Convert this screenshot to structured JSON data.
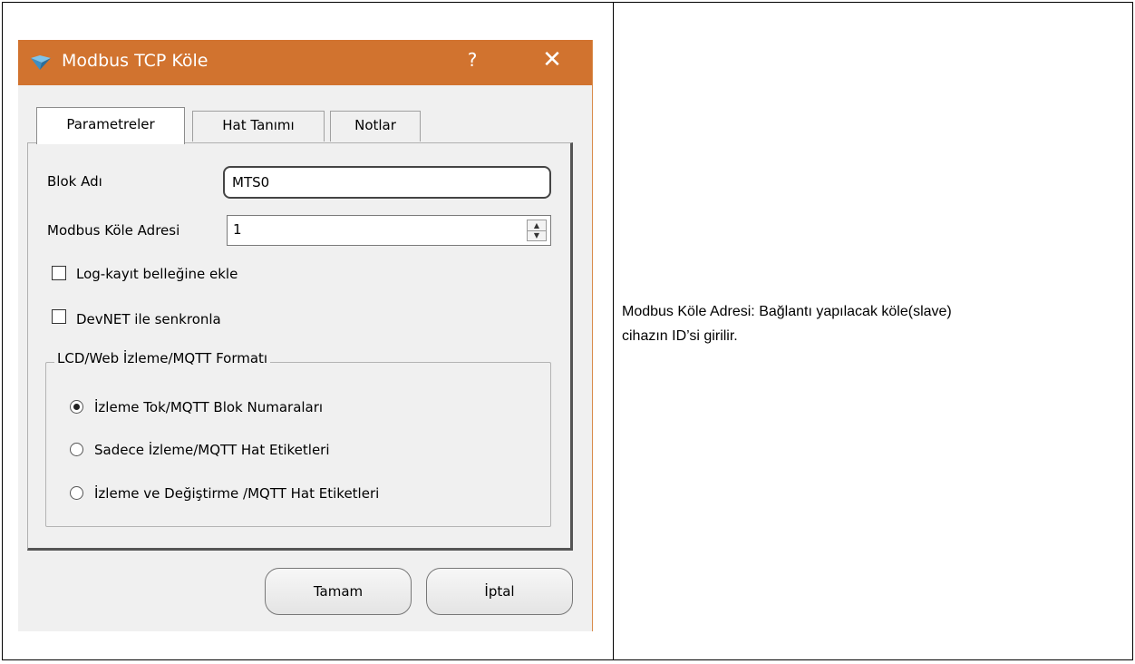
{
  "dialog": {
    "title": "Modbus TCP Köle",
    "help_label": "?",
    "close_label": "✕",
    "tabs": [
      {
        "label": "Parametreler",
        "active": true
      },
      {
        "label": "Hat Tanımı",
        "active": false
      },
      {
        "label": "Notlar",
        "active": false
      }
    ],
    "fields": {
      "block_name_label": "Blok Adı",
      "block_name_value": "MTS0",
      "slave_address_label": "Modbus Köle Adresi",
      "slave_address_value": "1"
    },
    "checkboxes": [
      {
        "label": "Log-kayıt belleğine ekle",
        "checked": false
      },
      {
        "label": "DevNET ile senkronla",
        "checked": false
      }
    ],
    "group": {
      "title": "LCD/Web İzleme/MQTT Formatı",
      "options": [
        {
          "label": "İzleme Tok/MQTT Blok Numaraları",
          "checked": true
        },
        {
          "label": "Sadece İzleme/MQTT Hat Etiketleri",
          "checked": false
        },
        {
          "label": "İzleme ve Değiştirme /MQTT Hat Etiketleri",
          "checked": false
        }
      ]
    },
    "buttons": {
      "ok_label": "Tamam",
      "cancel_label": "İptal"
    }
  },
  "description": {
    "line1": "Modbus Köle Adresi:  Bağlantı yapılacak köle(slave)",
    "line2": "cihazın ID’si girilir."
  },
  "colors": {
    "titlebar": "#d1732f",
    "dialog_bg": "#f0f0f0"
  }
}
